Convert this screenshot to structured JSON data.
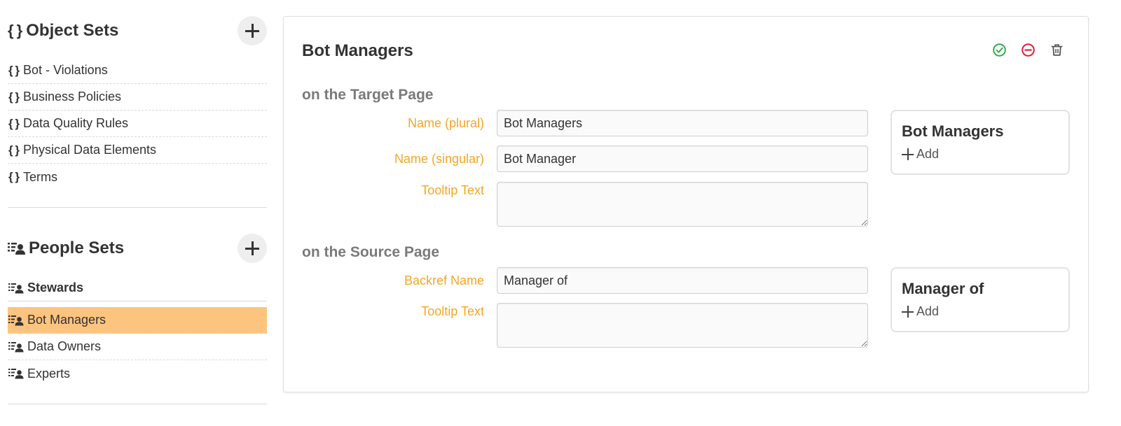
{
  "sidebar": {
    "object_sets": {
      "title": "Object Sets",
      "icon": "curly-braces-icon",
      "items": [
        {
          "label": "Bot - Violations"
        },
        {
          "label": "Business Policies"
        },
        {
          "label": "Data Quality Rules"
        },
        {
          "label": "Physical Data Elements"
        },
        {
          "label": "Terms"
        }
      ]
    },
    "people_sets": {
      "title": "People Sets",
      "icon": "people-list-icon",
      "items": [
        {
          "label": "Stewards",
          "bold": true
        },
        {
          "label": "Bot Managers",
          "selected": true
        },
        {
          "label": "Data Owners"
        },
        {
          "label": "Experts"
        }
      ]
    }
  },
  "editor": {
    "title": "Bot Managers",
    "actions": [
      "check-circle-icon",
      "minus-circle-icon",
      "trash-icon"
    ],
    "target": {
      "heading": "on the Target Page",
      "name_plural_label": "Name (plural)",
      "name_plural_value": "Bot Managers",
      "name_singular_label": "Name (singular)",
      "name_singular_value": "Bot Manager",
      "tooltip_label": "Tooltip Text",
      "tooltip_value": "",
      "preview_title": "Bot Managers",
      "preview_add": "Add"
    },
    "source": {
      "heading": "on the Source Page",
      "backref_label": "Backref Name",
      "backref_value": "Manager of",
      "tooltip_label": "Tooltip Text",
      "tooltip_value": "",
      "preview_title": "Manager of",
      "preview_add": "Add"
    }
  },
  "colors": {
    "accent_label": "#f5a623",
    "selected_row": "#fdc47f",
    "approve": "#3aaa55",
    "remove": "#e0203a",
    "subhead": "#7a7a7a"
  }
}
